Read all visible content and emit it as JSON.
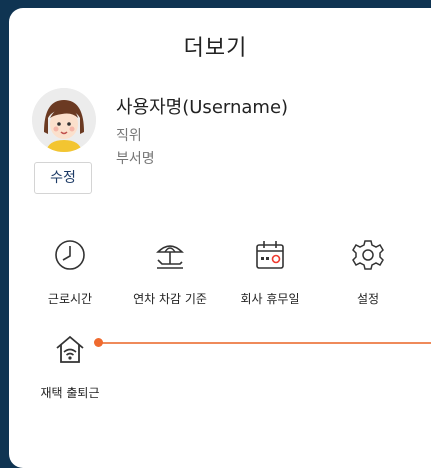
{
  "header": {
    "title": "더보기"
  },
  "profile": {
    "username": "사용자명(Username)",
    "position": "직위",
    "department": "부서명",
    "edit_label": "수정"
  },
  "menu": [
    {
      "label": "근로시간",
      "icon": "clock-icon"
    },
    {
      "label": "연차 차감 기준",
      "icon": "beach-umbrella-icon"
    },
    {
      "label": "회사 휴무일",
      "icon": "calendar-icon"
    },
    {
      "label": "설정",
      "icon": "gear-icon"
    },
    {
      "label": "재택 출퇴근",
      "icon": "home-wifi-icon"
    }
  ],
  "colors": {
    "accent": "#ef6a2e",
    "frame": "#0f3452",
    "name_text": "#1d3b66"
  }
}
